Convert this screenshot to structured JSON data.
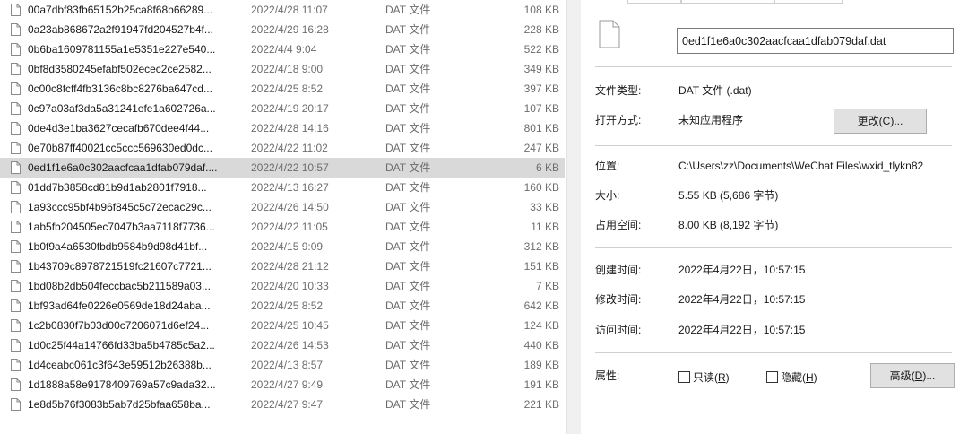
{
  "file_list": {
    "rows": [
      {
        "name": "00a7dbf83fb65152b25ca8f68b66289...",
        "date": "2022/4/28 11:07",
        "type": "DAT 文件",
        "size": "108 KB"
      },
      {
        "name": "0a23ab868672a2f91947fd204527b4f...",
        "date": "2022/4/29 16:28",
        "type": "DAT 文件",
        "size": "228 KB"
      },
      {
        "name": "0b6ba1609781155a1e5351e227e540...",
        "date": "2022/4/4 9:04",
        "type": "DAT 文件",
        "size": "522 KB"
      },
      {
        "name": "0bf8d3580245efabf502ecec2ce2582...",
        "date": "2022/4/18 9:00",
        "type": "DAT 文件",
        "size": "349 KB"
      },
      {
        "name": "0c00c8fcff4fb3136c8bc8276ba647cd...",
        "date": "2022/4/25 8:52",
        "type": "DAT 文件",
        "size": "397 KB"
      },
      {
        "name": "0c97a03af3da5a31241efe1a602726a...",
        "date": "2022/4/19 20:17",
        "type": "DAT 文件",
        "size": "107 KB"
      },
      {
        "name": "0de4d3e1ba3627cecafb670dee4f44...",
        "date": "2022/4/28 14:16",
        "type": "DAT 文件",
        "size": "801 KB"
      },
      {
        "name": "0e70b87ff40021cc5ccc569630ed0dc...",
        "date": "2022/4/22 11:02",
        "type": "DAT 文件",
        "size": "247 KB"
      },
      {
        "name": "0ed1f1e6a0c302aacfcaa1dfab079daf....",
        "date": "2022/4/22 10:57",
        "type": "DAT 文件",
        "size": "6 KB"
      },
      {
        "name": "01dd7b3858cd81b9d1ab2801f7918...",
        "date": "2022/4/13 16:27",
        "type": "DAT 文件",
        "size": "160 KB"
      },
      {
        "name": "1a93ccc95bf4b96f845c5c72ecac29c...",
        "date": "2022/4/26 14:50",
        "type": "DAT 文件",
        "size": "33 KB"
      },
      {
        "name": "1ab5fb204505ec7047b3aa7118f7736...",
        "date": "2022/4/22 11:05",
        "type": "DAT 文件",
        "size": "11 KB"
      },
      {
        "name": "1b0f9a4a6530fbdb9584b9d98d41bf...",
        "date": "2022/4/15 9:09",
        "type": "DAT 文件",
        "size": "312 KB"
      },
      {
        "name": "1b43709c8978721519fc21607c7721...",
        "date": "2022/4/28 21:12",
        "type": "DAT 文件",
        "size": "151 KB"
      },
      {
        "name": "1bd08b2db504feccbac5b211589a03...",
        "date": "2022/4/20 10:33",
        "type": "DAT 文件",
        "size": "7 KB"
      },
      {
        "name": "1bf93ad64fe0226e0569de18d24aba...",
        "date": "2022/4/25 8:52",
        "type": "DAT 文件",
        "size": "642 KB"
      },
      {
        "name": "1c2b0830f7b03d00c7206071d6ef24...",
        "date": "2022/4/25 10:45",
        "type": "DAT 文件",
        "size": "124 KB"
      },
      {
        "name": "1d0c25f44a14766fd33ba5b4785c5a2...",
        "date": "2022/4/26 14:53",
        "type": "DAT 文件",
        "size": "440 KB"
      },
      {
        "name": "1d4ceabc061c3f643e59512b26388b...",
        "date": "2022/4/13 8:57",
        "type": "DAT 文件",
        "size": "189 KB"
      },
      {
        "name": "1d1888a58e9178409769a57c9ada32...",
        "date": "2022/4/27 9:49",
        "type": "DAT 文件",
        "size": "191 KB"
      },
      {
        "name": "1e8d5b76f3083b5ab7d25bfaa658ba...",
        "date": "2022/4/27 9:47",
        "type": "DAT 文件",
        "size": "221 KB"
      }
    ]
  },
  "properties": {
    "file_name": "0ed1f1e6a0c302aacfcaa1dfab079daf.dat",
    "labels": {
      "file_type": "文件类型:",
      "open_with": "打开方式:",
      "location": "位置:",
      "size": "大小:",
      "size_on_disk": "占用空间:",
      "created": "创建时间:",
      "modified": "修改时间:",
      "accessed": "访问时间:",
      "attributes": "属性:"
    },
    "values": {
      "file_type": "DAT 文件 (.dat)",
      "open_with": "未知应用程序",
      "location": "C:\\Users\\zz\\Documents\\WeChat Files\\wxid_tlykn82",
      "size": "5.55 KB (5,686 字节)",
      "size_on_disk": "8.00 KB (8,192 字节)",
      "created": "2022年4月22日，10:57:15",
      "modified": "2022年4月22日，10:57:15",
      "accessed": "2022年4月22日，10:57:15"
    },
    "change_button": {
      "text": "更改(",
      "key": "C",
      "suffix": ")..."
    },
    "advanced_button": {
      "text": "高级(",
      "key": "D",
      "suffix": ")..."
    },
    "readonly": {
      "text": "只读(",
      "key": "R",
      "suffix": ")"
    },
    "hidden": {
      "text": "隐藏(",
      "key": "H",
      "suffix": ")"
    }
  },
  "colors": {
    "selected_row": "#d9d9d9",
    "secondary_text": "#6d6d6d",
    "button_face": "#e1e1e1"
  }
}
